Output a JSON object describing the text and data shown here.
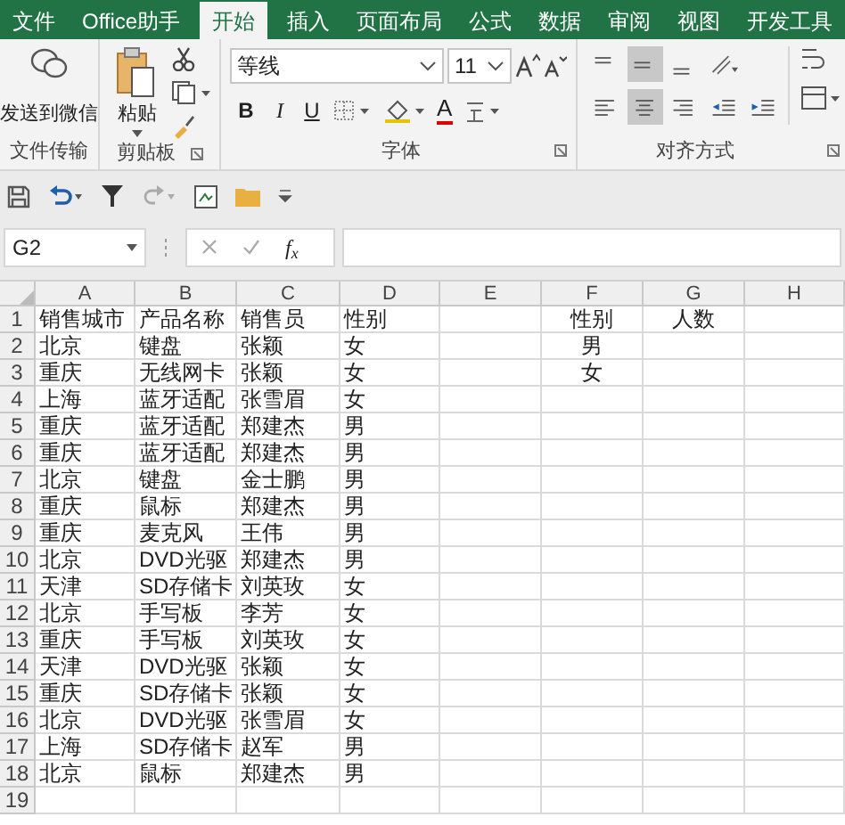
{
  "tabs": [
    {
      "label": "文件",
      "selected": false
    },
    {
      "label": "Office助手",
      "selected": false
    },
    {
      "label": "开始",
      "selected": true
    },
    {
      "label": "插入",
      "selected": false
    },
    {
      "label": "页面布局",
      "selected": false
    },
    {
      "label": "公式",
      "selected": false
    },
    {
      "label": "数据",
      "selected": false
    },
    {
      "label": "审阅",
      "selected": false
    },
    {
      "label": "视图",
      "selected": false
    },
    {
      "label": "开发工具",
      "selected": false
    }
  ],
  "ribbon": {
    "wechat": {
      "label": "发送到微信",
      "group": "文件传输"
    },
    "clipboard": {
      "paste": "粘贴",
      "group": "剪贴板"
    },
    "font": {
      "name": "等线",
      "size": "11",
      "bold": "B",
      "italic": "I",
      "underline": "U",
      "font_color": "A",
      "group": "字体"
    },
    "alignment": {
      "group": "对齐方式",
      "buttons": [
        {
          "kind": "top",
          "selected": false
        },
        {
          "kind": "middle",
          "selected": true
        },
        {
          "kind": "bottom",
          "selected": false
        },
        {
          "kind": "orientation",
          "selected": false
        },
        {
          "kind": "left",
          "selected": false
        },
        {
          "kind": "center",
          "selected": true
        },
        {
          "kind": "right",
          "selected": false
        },
        {
          "kind": "outdent",
          "selected": false
        },
        {
          "kind": "indent",
          "selected": false
        }
      ]
    }
  },
  "name_box": "G2",
  "formula_bar": {
    "function_label": "f$_{x}$"
  },
  "grid": {
    "columns": [
      "A",
      "B",
      "C",
      "D",
      "E",
      "F",
      "G",
      "H"
    ],
    "rows": [
      {
        "number": "1",
        "A": "销售城市",
        "B": "产品名称",
        "C": "销售员",
        "D": "性别",
        "F": "性别",
        "G": "人数"
      },
      {
        "number": "2",
        "A": "北京",
        "B": "键盘",
        "C": "张颖",
        "D": "女",
        "F": "男"
      },
      {
        "number": "3",
        "A": "重庆",
        "B": "无线网卡",
        "C": "张颖",
        "D": "女",
        "F": "女"
      },
      {
        "number": "4",
        "A": "上海",
        "B": "蓝牙适配",
        "C": "张雪眉",
        "D": "女"
      },
      {
        "number": "5",
        "A": "重庆",
        "B": "蓝牙适配",
        "C": "郑建杰",
        "D": "男"
      },
      {
        "number": "6",
        "A": "重庆",
        "B": "蓝牙适配",
        "C": "郑建杰",
        "D": "男"
      },
      {
        "number": "7",
        "A": "北京",
        "B": "键盘",
        "C": "金士鹏",
        "D": "男"
      },
      {
        "number": "8",
        "A": "重庆",
        "B": "鼠标",
        "C": "郑建杰",
        "D": "男"
      },
      {
        "number": "9",
        "A": "重庆",
        "B": "麦克风",
        "C": "王伟",
        "D": "男"
      },
      {
        "number": "10",
        "A": "北京",
        "B": "DVD光驱",
        "C": "郑建杰",
        "D": "男"
      },
      {
        "number": "11",
        "A": "天津",
        "B": "SD存储卡",
        "C": "刘英玫",
        "D": "女"
      },
      {
        "number": "12",
        "A": "北京",
        "B": "手写板",
        "C": "李芳",
        "D": "女"
      },
      {
        "number": "13",
        "A": "重庆",
        "B": "手写板",
        "C": "刘英玫",
        "D": "女"
      },
      {
        "number": "14",
        "A": "天津",
        "B": "DVD光驱",
        "C": "张颖",
        "D": "女"
      },
      {
        "number": "15",
        "A": "重庆",
        "B": "SD存储卡",
        "C": "张颖",
        "D": "女"
      },
      {
        "number": "16",
        "A": "北京",
        "B": "DVD光驱",
        "C": "张雪眉",
        "D": "女"
      },
      {
        "number": "17",
        "A": "上海",
        "B": "SD存储卡",
        "C": "赵军",
        "D": "男"
      },
      {
        "number": "18",
        "A": "北京",
        "B": "鼠标",
        "C": "郑建杰",
        "D": "男"
      },
      {
        "number": "19"
      }
    ]
  }
}
